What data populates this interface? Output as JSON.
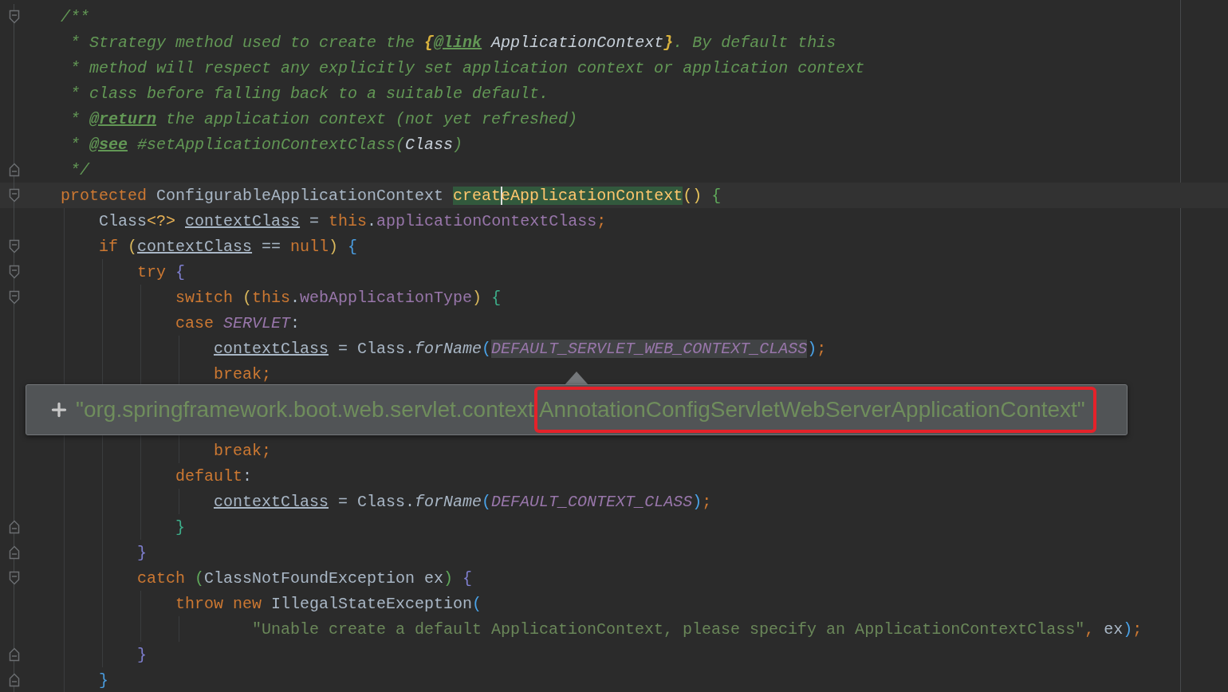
{
  "lines": [
    {
      "kind": "code",
      "fold": {
        "kind": "open"
      },
      "current": false,
      "tokens": [
        {
          "t": "/**",
          "kind": "doc"
        }
      ]
    },
    {
      "kind": "doc",
      "current": false,
      "tokens": [
        {
          "t": "* Strategy method used to create the ",
          "kind": "doc"
        },
        {
          "t": "{",
          "kind": "docbrace"
        },
        {
          "t": "@link",
          "kind": "doctag"
        },
        {
          "t": " ApplicationContext",
          "kind": "docref"
        },
        {
          "t": "}",
          "kind": "docbrace"
        },
        {
          "t": ". By default this",
          "kind": "doc"
        }
      ]
    },
    {
      "kind": "doc",
      "current": false,
      "tokens": [
        {
          "t": "* method will respect any explicitly set application context or application context",
          "kind": "doc"
        }
      ]
    },
    {
      "kind": "doc",
      "current": false,
      "tokens": [
        {
          "t": "* class before falling back to a suitable default.",
          "kind": "doc"
        }
      ]
    },
    {
      "kind": "doc",
      "current": false,
      "tokens": [
        {
          "t": "* ",
          "kind": "doc"
        },
        {
          "t": "@return",
          "kind": "doctag"
        },
        {
          "t": " the application context (not yet refreshed)",
          "kind": "doc"
        }
      ]
    },
    {
      "kind": "doc",
      "current": false,
      "tokens": [
        {
          "t": "* ",
          "kind": "doc"
        },
        {
          "t": "@see",
          "kind": "doctag"
        },
        {
          "t": " #setApplicationContextClass(",
          "kind": "doc"
        },
        {
          "t": "Class",
          "kind": "docref"
        },
        {
          "t": ")",
          "kind": "doc"
        }
      ]
    },
    {
      "kind": "doc",
      "fold": {
        "kind": "close"
      },
      "current": false,
      "tokens": [
        {
          "t": "*/",
          "kind": "doc"
        }
      ]
    },
    {
      "kind": "code",
      "fold": {
        "kind": "open"
      },
      "current": true,
      "tokens": [
        {
          "t": "protected",
          "kind": "kw"
        },
        {
          "t": " ConfigurableApplicationContext ",
          "kind": "plain"
        },
        {
          "t": "creat",
          "kind": "decl"
        },
        {
          "t": "eApplicationContext",
          "kind": "decl",
          "caret": true
        },
        {
          "t": "()",
          "kind": "br",
          "color": "#e6c35c"
        },
        {
          "t": " {",
          "kind": "br",
          "color": "#5fa85a"
        }
      ],
      "children": [
        {
          "kind": "code",
          "current": false,
          "tokens": [
            {
              "t": "Class",
              "kind": "plain"
            },
            {
              "t": "<?> ",
              "kind": "br",
              "color": "#e8b255"
            },
            {
              "t": "contextClass",
              "kind": "var"
            },
            {
              "t": " = ",
              "kind": "plain"
            },
            {
              "t": "this",
              "kind": "kw"
            },
            {
              "t": ".",
              "kind": "plain"
            },
            {
              "t": "applicationContextClass",
              "kind": "member"
            },
            {
              "t": ";",
              "kind": "kw"
            }
          ]
        },
        {
          "kind": "code",
          "fold": {
            "kind": "open"
          },
          "current": false,
          "tokens": [
            {
              "t": "if",
              "kind": "kw"
            },
            {
              "t": " (",
              "kind": "br",
              "color": "#d9b85c"
            },
            {
              "t": "contextClass",
              "kind": "var"
            },
            {
              "t": " == ",
              "kind": "plain"
            },
            {
              "t": "null",
              "kind": "kw"
            },
            {
              "t": ")",
              "kind": "br",
              "color": "#d9b85c"
            },
            {
              "t": " {",
              "kind": "br",
              "color": "#4a9de0"
            }
          ],
          "children": [
            {
              "kind": "code",
              "fold": {
                "kind": "open"
              },
              "current": false,
              "tokens": [
                {
                  "t": "try",
                  "kind": "kw"
                },
                {
                  "t": " {",
                  "kind": "br",
                  "color": "#7f7fd0"
                }
              ],
              "children": [
                {
                  "kind": "code",
                  "fold": {
                    "kind": "open"
                  },
                  "current": false,
                  "tokens": [
                    {
                      "t": "switch",
                      "kind": "kw"
                    },
                    {
                      "t": " (",
                      "kind": "br",
                      "color": "#d9b85c"
                    },
                    {
                      "t": "this",
                      "kind": "kw"
                    },
                    {
                      "t": ".",
                      "kind": "plain"
                    },
                    {
                      "t": "webApplicationType",
                      "kind": "member"
                    },
                    {
                      "t": ")",
                      "kind": "br",
                      "color": "#d9b85c"
                    },
                    {
                      "t": " {",
                      "kind": "br",
                      "color": "#3dae8a"
                    }
                  ]
                },
                {
                  "kind": "code",
                  "current": false,
                  "tokens": [
                    {
                      "t": "case ",
                      "kind": "kw"
                    },
                    {
                      "t": "SERVLET",
                      "kind": "const"
                    },
                    {
                      "t": ":",
                      "kind": "plain"
                    }
                  ],
                  "children": [
                    {
                      "kind": "code",
                      "current": false,
                      "tokens": [
                        {
                          "t": "contextClass",
                          "kind": "var"
                        },
                        {
                          "t": " = Class.",
                          "kind": "plain"
                        },
                        {
                          "t": "forName",
                          "kind": "static"
                        },
                        {
                          "t": "(",
                          "kind": "br",
                          "color": "#4aa3e8"
                        },
                        {
                          "t": "DEFAULT_SERVLET_WEB_CONTEXT_CLASS",
                          "kind": "const",
                          "hover": true
                        },
                        {
                          "t": ")",
                          "kind": "br",
                          "color": "#4aa3e8"
                        },
                        {
                          "t": ";",
                          "kind": "kw"
                        }
                      ]
                    },
                    {
                      "kind": "code",
                      "current": false,
                      "tokens": [
                        {
                          "t": "break;",
                          "kind": "kw"
                        }
                      ]
                    }
                  ]
                },
                {
                  "kind": "blank",
                  "current": false,
                  "children": [
                    {
                      "kind": "blank",
                      "current": false
                    },
                    {
                      "kind": "code",
                      "current": false,
                      "tokens": [
                        {
                          "t": "break;",
                          "kind": "kw"
                        }
                      ]
                    }
                  ]
                },
                {
                  "kind": "code",
                  "current": false,
                  "tokens": [
                    {
                      "t": "default",
                      "kind": "kw"
                    },
                    {
                      "t": ":",
                      "kind": "plain"
                    }
                  ],
                  "children": [
                    {
                      "kind": "code",
                      "current": false,
                      "tokens": [
                        {
                          "t": "contextClass",
                          "kind": "var"
                        },
                        {
                          "t": " = Class.",
                          "kind": "plain"
                        },
                        {
                          "t": "forName",
                          "kind": "static"
                        },
                        {
                          "t": "(",
                          "kind": "br",
                          "color": "#4aa3e8"
                        },
                        {
                          "t": "DEFAULT_CONTEXT_CLASS",
                          "kind": "const",
                          "hover": false
                        },
                        {
                          "t": ")",
                          "kind": "br",
                          "color": "#4aa3e8"
                        },
                        {
                          "t": ";",
                          "kind": "kw"
                        }
                      ]
                    }
                  ]
                },
                {
                  "kind": "code",
                  "fold": {
                    "kind": "close"
                  },
                  "current": false,
                  "tokens": [
                    {
                      "t": "}",
                      "kind": "br",
                      "color": "#3dae8a"
                    }
                  ]
                }
              ]
            },
            {
              "kind": "code",
              "fold": {
                "kind": "close"
              },
              "current": false,
              "tokens": [
                {
                  "t": "}",
                  "kind": "br",
                  "color": "#7f7fd0"
                }
              ]
            },
            {
              "kind": "code",
              "fold": {
                "kind": "open"
              },
              "current": false,
              "tokens": [
                {
                  "t": "catch",
                  "kind": "kw"
                },
                {
                  "t": " (",
                  "kind": "br",
                  "color": "#5fa85a"
                },
                {
                  "t": "ClassNotFoundException ex",
                  "kind": "plain"
                },
                {
                  "t": ")",
                  "kind": "br",
                  "color": "#5fa85a"
                },
                {
                  "t": " {",
                  "kind": "br",
                  "color": "#7f7fd0"
                }
              ],
              "children": [
                {
                  "kind": "code",
                  "current": false,
                  "tokens": [
                    {
                      "t": "throw new",
                      "kind": "kw"
                    },
                    {
                      "t": " IllegalStateException",
                      "kind": "plain"
                    },
                    {
                      "t": "(",
                      "kind": "br",
                      "color": "#4aa3e8"
                    }
                  ],
                  "children": [
                    {
                      "kind": "cont",
                      "current": false,
                      "tokens": [
                        {
                          "t": "\"Unable create a default ApplicationContext, please specify an ApplicationContextClass\"",
                          "kind": "str"
                        },
                        {
                          "t": ",",
                          "kind": "kw"
                        },
                        {
                          "t": " ex",
                          "kind": "plain"
                        },
                        {
                          "t": ")",
                          "kind": "br",
                          "color": "#4aa3e8"
                        },
                        {
                          "t": ";",
                          "kind": "kw"
                        }
                      ]
                    }
                  ]
                }
              ]
            },
            {
              "kind": "code",
              "fold": {
                "kind": "close"
              },
              "current": false,
              "tokens": [
                {
                  "t": "}",
                  "kind": "br",
                  "color": "#7f7fd0"
                }
              ]
            }
          ]
        },
        {
          "kind": "code",
          "fold": {
            "kind": "close"
          },
          "current": false,
          "tokens": [
            {
              "t": "}",
              "kind": "br",
              "color": "#4a9de0"
            }
          ]
        }
      ]
    }
  ],
  "popup": {
    "parts": [
      {
        "text": "\"org.springframework.boot.web.servlet.context",
        "boxed": false
      },
      {
        "text": "AnnotationConfigServletWebServerApplicationContext\"",
        "boxed": true
      }
    ]
  }
}
